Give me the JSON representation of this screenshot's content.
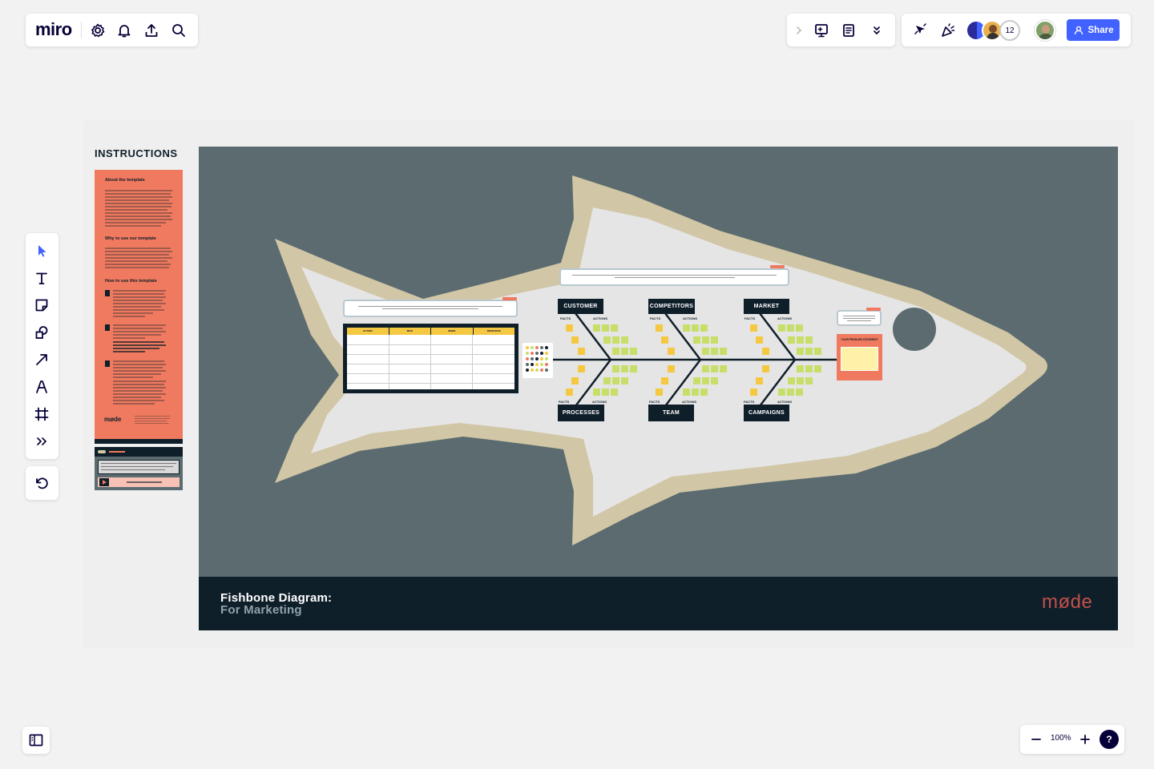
{
  "app": {
    "logo": "miro",
    "share_label": "Share",
    "collaborator_count": "12",
    "zoom": "100%",
    "help": "?"
  },
  "toolbar_left": [
    "settings-icon",
    "bell-icon",
    "upload-icon",
    "search-icon"
  ],
  "toolbar_right": [
    "present-icon",
    "notes-icon",
    "more-icon"
  ],
  "tools": [
    "select",
    "text",
    "sticky-note",
    "shapes",
    "arrow",
    "pen",
    "frame",
    "more"
  ],
  "board": {
    "instructions_title": "INSTRUCTIONS",
    "about_heading": "About the template",
    "why_heading": "Why to use our template",
    "how_heading": "How to use this template",
    "brand_small": "møde",
    "diagram_title_line1": "Fishbone Diagram:",
    "diagram_title_line2": "For Marketing",
    "brand_logo": "møde",
    "categories_top": [
      "CUSTOMER",
      "COMPETITORS",
      "MARKET"
    ],
    "categories_bottom": [
      "PROCESSES",
      "TEAM",
      "CAMPAIGNS"
    ],
    "facts_label": "FACTS",
    "actions_label": "ACTIONS",
    "problem_label": "YOUR PROBLEM STATEMENT",
    "table_headers": [
      "ACTION",
      "WHO",
      "WHEN",
      "RESOURCE"
    ]
  },
  "colors": {
    "board_bg": "#5b6b70",
    "fish_outline": "#d1c6a5",
    "fish_body": "#e5e5e5",
    "dark": "#0f1f2a",
    "coral": "#f07a5f",
    "sticky_yellow": "#f5c842",
    "sticky_green": "#c8de6a",
    "accent_blue": "#4262ff"
  }
}
